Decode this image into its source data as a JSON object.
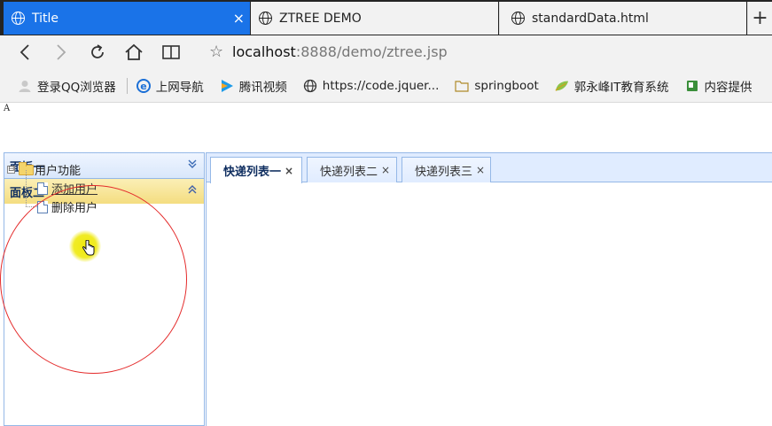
{
  "browser": {
    "tabs": [
      {
        "title": "Title",
        "active": true
      },
      {
        "title": "ZTREE DEMO",
        "active": false
      },
      {
        "title": "standardData.html",
        "active": false
      }
    ],
    "new_tab_label": "+",
    "close_label": "×",
    "url_host": "localhost",
    "url_rest": ":8888/demo/ztree.jsp",
    "bookmarks": [
      {
        "label": "登录QQ浏览器",
        "icon": "user-icon"
      },
      {
        "label": "上网导航",
        "icon": "ie-icon"
      },
      {
        "label": "腾讯视频",
        "icon": "play-icon"
      },
      {
        "label": "https://code.jquer...",
        "icon": "globe-icon"
      },
      {
        "label": "springboot",
        "icon": "folder-icon"
      },
      {
        "label": "郭永峰IT教育系统",
        "icon": "leaf-icon"
      },
      {
        "label": "内容提供",
        "icon": "book-icon"
      }
    ]
  },
  "page": {
    "top_char": "A",
    "accordion": {
      "panels": [
        {
          "title": "面板一",
          "expanded": false
        },
        {
          "title": "面板二",
          "expanded": true
        }
      ]
    },
    "tree": {
      "root": {
        "label": "用户功能",
        "switch": "⊟"
      },
      "children": [
        {
          "label": "添加用户",
          "hovered": true
        },
        {
          "label": "删除用户",
          "hovered": false
        }
      ]
    },
    "content_tabs": [
      {
        "label": "快递列表一",
        "selected": true
      },
      {
        "label": "快递列表二",
        "selected": false
      },
      {
        "label": "快递列表三",
        "selected": false
      }
    ],
    "tab_close": "×"
  },
  "colors": {
    "browser_accent": "#1a73e8",
    "panel_border": "#95b8e7",
    "selected_panel_header": "#f4dd80",
    "annotation_ring": "#e42b2b",
    "cursor_highlight": "#eee800"
  }
}
